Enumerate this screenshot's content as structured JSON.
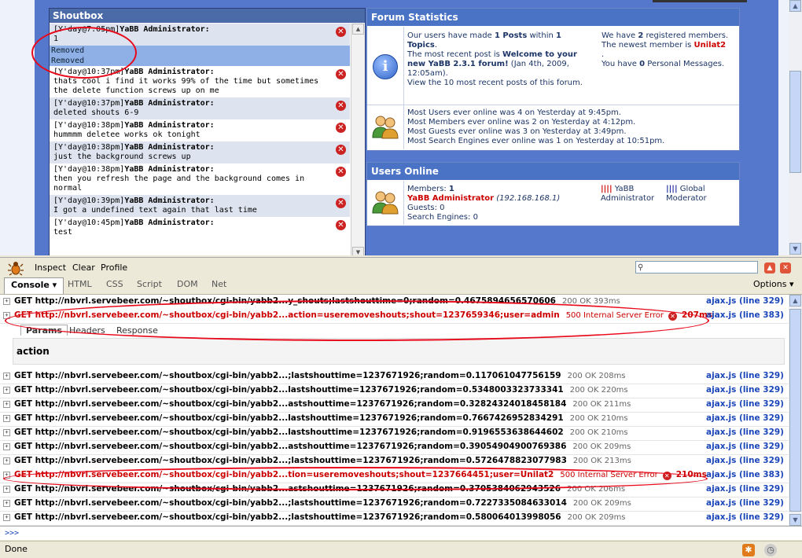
{
  "shoutbox": {
    "title": "Shoutbox",
    "items": [
      {
        "time": "[Y'day@7:05pm]",
        "author": "YaBB Administrator:",
        "text": "1",
        "removed": [
          "Removed",
          "Removed"
        ]
      },
      {
        "time": "[Y'day@10:37pm]",
        "author": "YaBB Administrator:",
        "text": "thats cool i find it works 99% of the time but sometimes the delete function screws up on me"
      },
      {
        "time": "[Y'day@10:37pm]",
        "author": "YaBB Administrator:",
        "text": "deleted shouts 6-9"
      },
      {
        "time": "[Y'day@10:38pm]",
        "author": "YaBB Administrator:",
        "text": "hummmm deletee works ok tonight"
      },
      {
        "time": "[Y'day@10:38pm]",
        "author": "YaBB Administrator:",
        "text": "just the background screws up"
      },
      {
        "time": "[Y'day@10:38pm]",
        "author": "YaBB Administrator:",
        "text": "then you refresh the page and the background comes in normal"
      },
      {
        "time": "[Y'day@10:39pm]",
        "author": "YaBB Administrator:",
        "text": "I got a undefined text again that last time"
      },
      {
        "time": "[Y'day@10:45pm]",
        "author": "YaBB Administrator:",
        "text": "test"
      }
    ]
  },
  "forum_stats": {
    "title": "Forum Statistics",
    "posts_line_a": "Our users have made ",
    "posts_count": "1 Posts",
    "posts_line_b": " within ",
    "topics_count": "1 Topics",
    "recent_a": "The most recent post is ",
    "recent_title": "Welcome to your new YaBB 2.3.1 forum!",
    "recent_date": " (Jan 4th, 2009, 12:05am).",
    "view_recent": "View the 10 most recent posts of this forum.",
    "registered_a": "We have ",
    "registered_count": "2",
    "registered_b": " registered members.",
    "newest_a": "The newest member is ",
    "newest_name": "Unilat2",
    "pm_a": "You have ",
    "pm_count": "0",
    "pm_b": " Personal Messages.",
    "online_users": "Most Users ever online was 4 on Yesterday at 9:45pm.",
    "online_members": "Most Members ever online was 2 on Yesterday at 4:12pm.",
    "online_guests": "Most Guests ever online was 3 on Yesterday at 3:49pm.",
    "online_search": "Most Search Engines ever online was 1 on Yesterday at 10:51pm."
  },
  "users_online": {
    "title": "Users Online",
    "members_label": "Members: ",
    "members_count": "1",
    "admin_name": "YaBB Administrator",
    "admin_ip": "(192.168.168.1)",
    "guests": "Guests: 0",
    "search_engines": "Search Engines: 0",
    "legend_admin": "YaBB Administrator",
    "legend_mod": "Global Moderator"
  },
  "firebug": {
    "toolbar": {
      "inspect": "Inspect",
      "clear": "Clear",
      "profile": "Profile"
    },
    "tabs": [
      "Console",
      "HTML",
      "CSS",
      "Script",
      "DOM",
      "Net"
    ],
    "options": "Options",
    "expanded_tabs": [
      "Params",
      "Headers",
      "Response"
    ],
    "param": "action",
    "rows": [
      {
        "req": "GET http://nbvrl.servebeer.com/~shoutbox/cgi-bin/yabb2...y_shouts;lastshouttime=0;random=0.4675894656570606",
        "status": "200 OK 393ms",
        "src": "ajax.js (line 329)",
        "err": false
      },
      {
        "req": "GET http://nbvrl.servebeer.com/~shoutbox/cgi-bin/yabb2...action=useremoveshouts;shout=1237659346;user=admin",
        "status": "500 Internal Server Error",
        "time": "207ms",
        "src": "ajax.js (line 383)",
        "err": true
      },
      {
        "req": "GET http://nbvrl.servebeer.com/~shoutbox/cgi-bin/yabb2...;lastshouttime=1237671926;random=0.117061047756159",
        "status": "200 OK 208ms",
        "src": "ajax.js (line 329)",
        "err": false
      },
      {
        "req": "GET http://nbvrl.servebeer.com/~shoutbox/cgi-bin/yabb2...lastshouttime=1237671926;random=0.5348003323733341",
        "status": "200 OK 220ms",
        "src": "ajax.js (line 329)",
        "err": false
      },
      {
        "req": "GET http://nbvrl.servebeer.com/~shoutbox/cgi-bin/yabb2...astshouttime=1237671926;random=0.32824324018458184",
        "status": "200 OK 211ms",
        "src": "ajax.js (line 329)",
        "err": false
      },
      {
        "req": "GET http://nbvrl.servebeer.com/~shoutbox/cgi-bin/yabb2...lastshouttime=1237671926;random=0.7667426952834291",
        "status": "200 OK 210ms",
        "src": "ajax.js (line 329)",
        "err": false
      },
      {
        "req": "GET http://nbvrl.servebeer.com/~shoutbox/cgi-bin/yabb2...lastshouttime=1237671926;random=0.9196553638644602",
        "status": "200 OK 210ms",
        "src": "ajax.js (line 329)",
        "err": false
      },
      {
        "req": "GET http://nbvrl.servebeer.com/~shoutbox/cgi-bin/yabb2...astshouttime=1237671926;random=0.39054904900769386",
        "status": "200 OK 209ms",
        "src": "ajax.js (line 329)",
        "err": false
      },
      {
        "req": "GET http://nbvrl.servebeer.com/~shoutbox/cgi-bin/yabb2...;lastshouttime=1237671926;random=0.5726478823077983",
        "status": "200 OK 213ms",
        "src": "ajax.js (line 329)",
        "err": false
      },
      {
        "req": "GET http://nbvrl.servebeer.com/~shoutbox/cgi-bin/yabb2...tion=useremoveshouts;shout=1237664451;user=Unilat2",
        "status": "500 Internal Server Error",
        "time": "210ms",
        "src": "ajax.js (line 383)",
        "err": true
      },
      {
        "req": "GET http://nbvrl.servebeer.com/~shoutbox/cgi-bin/yabb2...astshouttime=1237671926;random=0.3705384062943526",
        "status": "200 OK 206ms",
        "src": "ajax.js (line 329)",
        "err": false
      },
      {
        "req": "GET http://nbvrl.servebeer.com/~shoutbox/cgi-bin/yabb2...;lastshouttime=1237671926;random=0.7227335084633014",
        "status": "200 OK 209ms",
        "src": "ajax.js (line 329)",
        "err": false
      },
      {
        "req": "GET http://nbvrl.servebeer.com/~shoutbox/cgi-bin/yabb2...;lastshouttime=1237671926;random=0.580064013998056",
        "status": "200 OK 209ms",
        "src": "ajax.js (line 329)",
        "err": false
      }
    ],
    "prompt": ">>>"
  },
  "status_bar": {
    "text": "Done"
  },
  "colors": {
    "error": "#cc0000",
    "link_blue": "#1b46b8",
    "annotation_red": "#e8081a"
  }
}
